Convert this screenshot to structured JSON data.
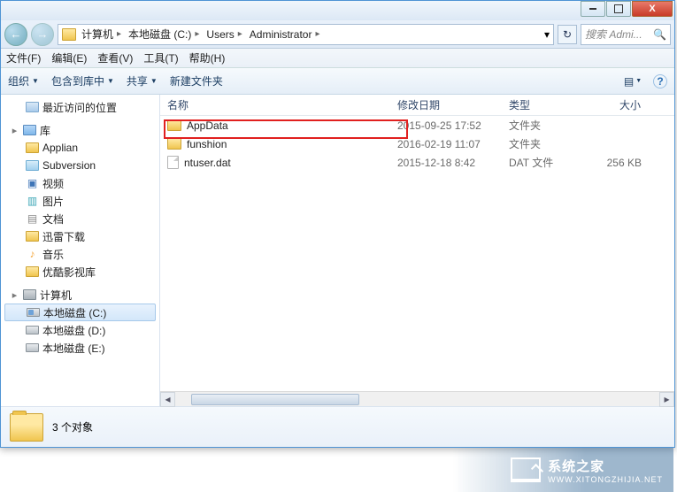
{
  "window": {
    "min_tip": "最小化",
    "max_tip": "最大化",
    "close_label": "X"
  },
  "nav": {
    "back": "←",
    "forward": "→"
  },
  "breadcrumbs": [
    "计算机",
    "本地磁盘 (C:)",
    "Users",
    "Administrator"
  ],
  "search": {
    "placeholder": "搜索 Admi...",
    "icon": "🔍"
  },
  "refresh_icon": "↻",
  "menu": {
    "file": "文件(F)",
    "edit": "编辑(E)",
    "view": "查看(V)",
    "tools": "工具(T)",
    "help": "帮助(H)"
  },
  "toolbar": {
    "organize": "组织",
    "include": "包含到库中",
    "share": "共享",
    "newfolder": "新建文件夹",
    "view_icon": "▤",
    "help_icon": "?"
  },
  "tree": {
    "recent": "最近访问的位置",
    "library": "库",
    "lib_items": [
      "Applian",
      "Subversion",
      "视频",
      "图片",
      "文档",
      "迅雷下载",
      "音乐",
      "优酷影视库"
    ],
    "computer": "计算机",
    "drives": [
      "本地磁盘 (C:)",
      "本地磁盘 (D:)",
      "本地磁盘 (E:)"
    ]
  },
  "columns": {
    "name": "名称",
    "date": "修改日期",
    "type": "类型",
    "size": "大小"
  },
  "files": [
    {
      "name": "AppData",
      "date": "2015-09-25 17:52",
      "type": "文件夹",
      "size": "",
      "icon": "folder",
      "highlighted": true
    },
    {
      "name": "funshion",
      "date": "2016-02-19 11:07",
      "type": "文件夹",
      "size": "",
      "icon": "folder"
    },
    {
      "name": "ntuser.dat",
      "date": "2015-12-18 8:42",
      "type": "DAT 文件",
      "size": "256 KB",
      "icon": "file"
    }
  ],
  "status": {
    "count": "3 个对象"
  },
  "watermark": {
    "line1": "系统之家",
    "line2": "WWW.XITONGZHIJIA.NET"
  }
}
